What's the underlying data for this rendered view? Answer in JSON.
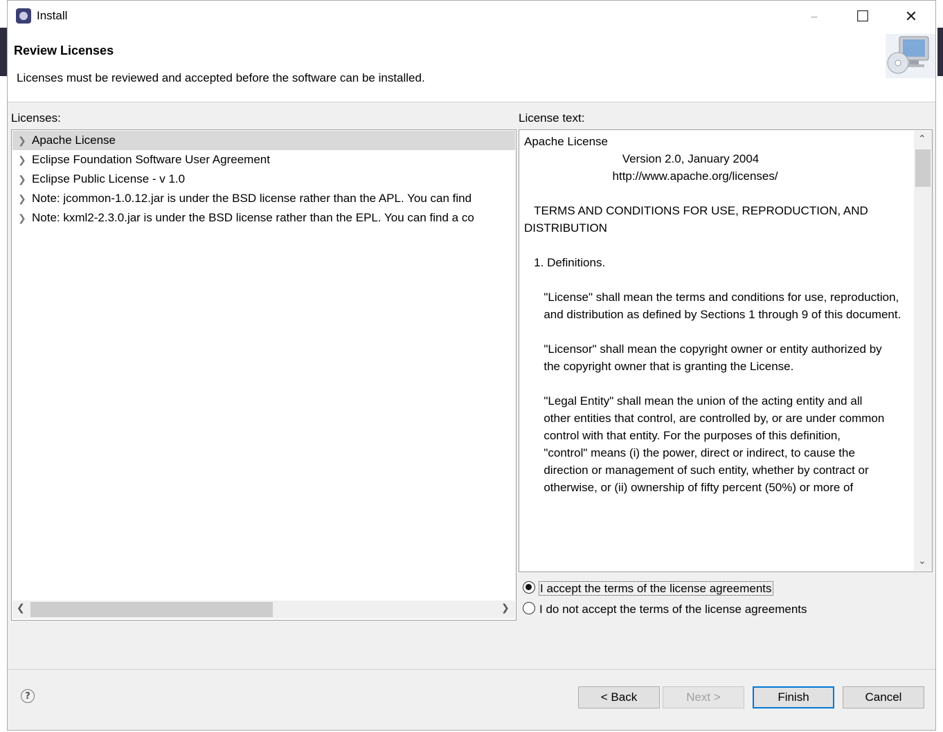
{
  "window": {
    "title": "Install",
    "minimize_glyph": "–",
    "maximize_glyph": "☐",
    "close_glyph": "✕"
  },
  "header": {
    "title": "Review Licenses",
    "description": "Licenses must be reviewed and accepted before the software can be installed.",
    "icon": "computer-cd-icon"
  },
  "licenses": {
    "label": "Licenses:",
    "items": [
      {
        "label": "Apache License",
        "selected": true
      },
      {
        "label": "Eclipse Foundation Software User Agreement",
        "selected": false
      },
      {
        "label": "Eclipse Public License - v 1.0",
        "selected": false
      },
      {
        "label": "Note:  jcommon-1.0.12.jar is under the BSD license rather than the APL.  You can find",
        "selected": false
      },
      {
        "label": "Note:  kxml2-2.3.0.jar is under the BSD license rather than the EPL.  You can find a co",
        "selected": false
      }
    ]
  },
  "license_text": {
    "label": "License text:",
    "content": "Apache License\n                              Version 2.0, January 2004\n                           http://www.apache.org/licenses/\n\n   TERMS AND CONDITIONS FOR USE, REPRODUCTION, AND DISTRIBUTION\n\n   1. Definitions.\n\n      \"License\" shall mean the terms and conditions for use, reproduction,\n      and distribution as defined by Sections 1 through 9 of this document.\n\n      \"Licensor\" shall mean the copyright owner or entity authorized by\n      the copyright owner that is granting the License.\n\n      \"Legal Entity\" shall mean the union of the acting entity and all\n      other entities that control, are controlled by, or are under common\n      control with that entity. For the purposes of this definition,\n      \"control\" means (i) the power, direct or indirect, to cause the\n      direction or management of such entity, whether by contract or\n      otherwise, or (ii) ownership of fifty percent (50%) or more of"
  },
  "accept": {
    "accept_label": "I accept the terms of the license agreements",
    "decline_label": "I do not accept the terms of the license agreements",
    "selected": "accept"
  },
  "buttons": {
    "help": "?",
    "back": "< Back",
    "next": "Next >",
    "finish": "Finish",
    "cancel": "Cancel"
  }
}
